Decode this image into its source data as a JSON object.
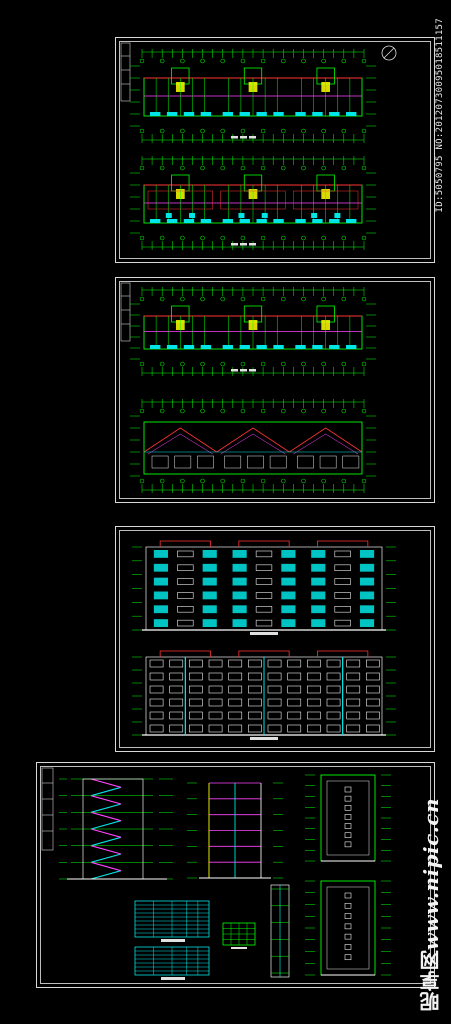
{
  "watermark": {
    "site": "www.nipic.cn",
    "brand": "昵享网"
  },
  "image_id": "ID:5050795 NO:20120730095018511157",
  "sheets": [
    {
      "name": "floor-plans-sheet"
    },
    {
      "name": "roof-and-floor-plans-sheet"
    },
    {
      "name": "elevations-sheet"
    },
    {
      "name": "sections-and-details-sheet"
    }
  ],
  "colors": {
    "background": "#000000",
    "frame": "#d8d8d8",
    "wall": "#00ff00",
    "accent": "#ff3333",
    "cyan": "#00e5e5",
    "magenta": "#ff44ff",
    "yellow": "#ffff00"
  }
}
